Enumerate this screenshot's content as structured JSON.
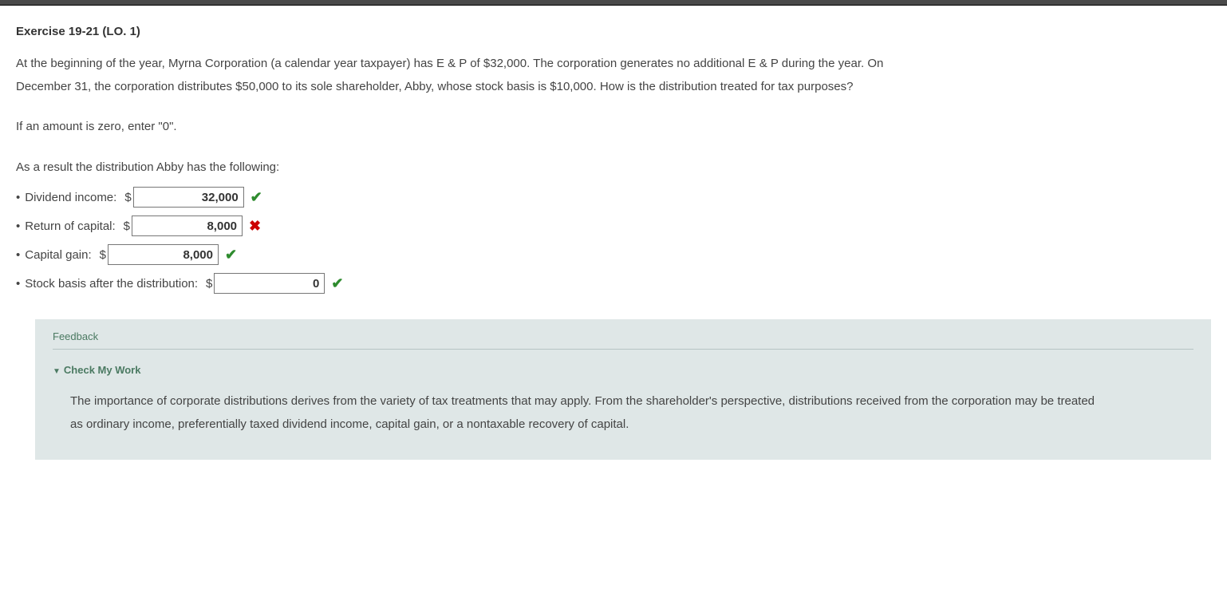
{
  "title": "Exercise 19-21 (LO. 1)",
  "problem": "At the beginning of the year, Myrna Corporation (a calendar year taxpayer) has E & P of $32,000. The corporation generates no additional E & P during the year. On December 31, the corporation distributes $50,000 to its sole shareholder, Abby, whose stock basis is $10,000. How is the distribution treated for tax purposes?",
  "instruction": "If an amount is zero, enter \"0\".",
  "lead": "As a result the distribution Abby has the following:",
  "rows": {
    "dividend": {
      "label": "Dividend income:",
      "value": "32,000",
      "correct": true
    },
    "return_cap": {
      "label": "Return of capital:",
      "value": "8,000",
      "correct": false
    },
    "capital_gain": {
      "label": "Capital gain:",
      "value": "8,000",
      "correct": true
    },
    "stock_basis": {
      "label": "Stock basis after the distribution:",
      "value": "0",
      "correct": true
    }
  },
  "feedback": {
    "title": "Feedback",
    "check_label": "Check My Work",
    "body": "The importance of corporate distributions derives from the variety of tax treatments that may apply. From the shareholder's perspective, distributions received from the corporation may be treated as ordinary income, preferentially taxed dividend income, capital gain, or a nontaxable recovery of capital."
  },
  "glyphs": {
    "check": "✔",
    "cross": "✖",
    "down": "▼",
    "bullet": "•",
    "dollar": "$"
  }
}
